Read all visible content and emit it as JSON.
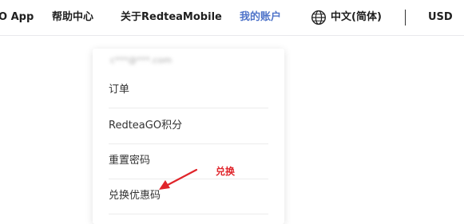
{
  "nav": {
    "app_link": "O App",
    "help_center": "帮助中心",
    "about": "关于RedteaMobile",
    "my_account": "我的账户",
    "language": "中文(简体)",
    "currency": "USD"
  },
  "account_menu": {
    "email": "c***@***.com",
    "items": [
      {
        "label": "订单"
      },
      {
        "label": "RedteaGO积分"
      },
      {
        "label": "重置密码"
      },
      {
        "label": "兑换优惠码"
      }
    ]
  },
  "annotation": {
    "label": "兑换",
    "color": "#e0242a"
  },
  "colors": {
    "active_nav": "#4f74c9",
    "text": "#1f1f1f"
  },
  "icons": {
    "language": "globe-icon",
    "pointer": "red-arrow"
  }
}
